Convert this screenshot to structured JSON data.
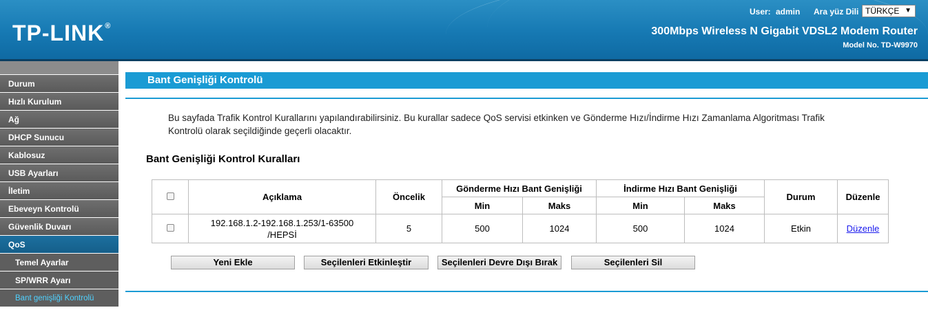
{
  "header": {
    "logo": "TP-LINK",
    "logo_mark": "®",
    "user_label": "User:",
    "user_name": "admin",
    "lang_label": "Ara yüz Dili",
    "lang_value": "TÜRKÇE",
    "product_title": "300Mbps Wireless N Gigabit VDSL2 Modem Router",
    "model_no": "Model No. TD-W9970"
  },
  "sidebar": {
    "items": [
      {
        "label": "Durum"
      },
      {
        "label": "Hızlı Kurulum"
      },
      {
        "label": "Ağ"
      },
      {
        "label": "DHCP Sunucu"
      },
      {
        "label": "Kablosuz"
      },
      {
        "label": "USB Ayarları"
      },
      {
        "label": "İletim"
      },
      {
        "label": "Ebeveyn Kontrolü"
      },
      {
        "label": "Güvenlik Duvarı"
      },
      {
        "label": "QoS"
      }
    ],
    "sub_items": [
      {
        "label": "Temel Ayarlar"
      },
      {
        "label": "SP/WRR Ayarı"
      },
      {
        "label": "Bant genişliği Kontrolü"
      }
    ]
  },
  "main": {
    "title": "Bant Genişliği Kontrolü",
    "description": "Bu sayfada Trafik Kontrol Kurallarını yapılandırabilirsiniz. Bu kurallar sadece QoS servisi etkinken ve Gönderme Hızı/İndirme Hızı Zamanlama Algoritması Trafik Kontrolü olarak seçildiğinde geçerli olacaktır.",
    "section_title": "Bant Genişliği Kontrol Kuralları",
    "table": {
      "headers": {
        "description": "Açıklama",
        "priority": "Öncelik",
        "upload": "Gönderme Hızı Bant Genişliği",
        "download": "İndirme Hızı Bant Genişliği",
        "min": "Min",
        "max": "Maks",
        "status": "Durum",
        "edit": "Düzenle"
      },
      "rows": [
        {
          "description_line1": "192.168.1.2-192.168.1.253/1-63500",
          "description_line2": "/HEPSİ",
          "priority": "5",
          "up_min": "500",
          "up_max": "1024",
          "down_min": "500",
          "down_max": "1024",
          "status": "Etkin",
          "edit": "Düzenle"
        }
      ]
    },
    "buttons": {
      "add": "Yeni Ekle",
      "enable": "Seçilenleri Etkinleştir",
      "disable": "Seçilenleri Devre Dışı Bırak",
      "delete": "Seçilenleri Sil"
    }
  },
  "colors": {
    "header_blue": "#1679b3",
    "accent_blue": "#1a9bd4",
    "nav_gray": "#5a5a5a",
    "nav_active": "#155f8a",
    "current_sub": "#4fd1ff"
  }
}
